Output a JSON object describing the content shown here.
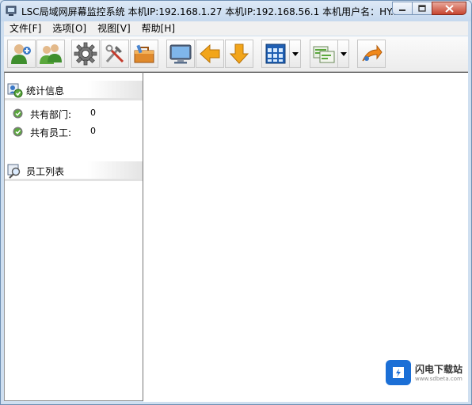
{
  "window": {
    "title": "LSC局域网屏幕监控系统    本机IP:192.168.1.27   本机IP:192.168.56.1    本机用户名：HY...",
    "controls": [
      "minimize",
      "maximize",
      "close"
    ]
  },
  "menu": {
    "items": [
      {
        "label": "文件[F]"
      },
      {
        "label": "选项[O]"
      },
      {
        "label": "视图[V]"
      },
      {
        "label": "帮助[H]"
      }
    ]
  },
  "toolbar": {
    "buttons": [
      {
        "icon": "add-user-icon"
      },
      {
        "icon": "users-icon"
      },
      {
        "icon": "gear-icon"
      },
      {
        "icon": "tools-icon"
      },
      {
        "icon": "toolbox-icon"
      },
      {
        "icon": "monitor-icon"
      },
      {
        "icon": "arrow-left-icon"
      },
      {
        "icon": "arrow-down-icon"
      },
      {
        "icon": "grid-view-icon",
        "dropdown": true
      },
      {
        "icon": "list-view-icon",
        "dropdown": true
      },
      {
        "icon": "export-icon"
      }
    ]
  },
  "left_panel": {
    "stats": {
      "title": "统计信息",
      "rows": [
        {
          "label": "共有部门:",
          "value": "0"
        },
        {
          "label": "共有员工:",
          "value": "0"
        }
      ]
    },
    "employees": {
      "title": "员工列表"
    }
  },
  "watermark": {
    "text": "闪电下载站",
    "url": "www.sdbeta.com"
  },
  "colors": {
    "accent": "#1b6fd6",
    "check": "#5aa83c",
    "arrow": "#f2a51a"
  }
}
